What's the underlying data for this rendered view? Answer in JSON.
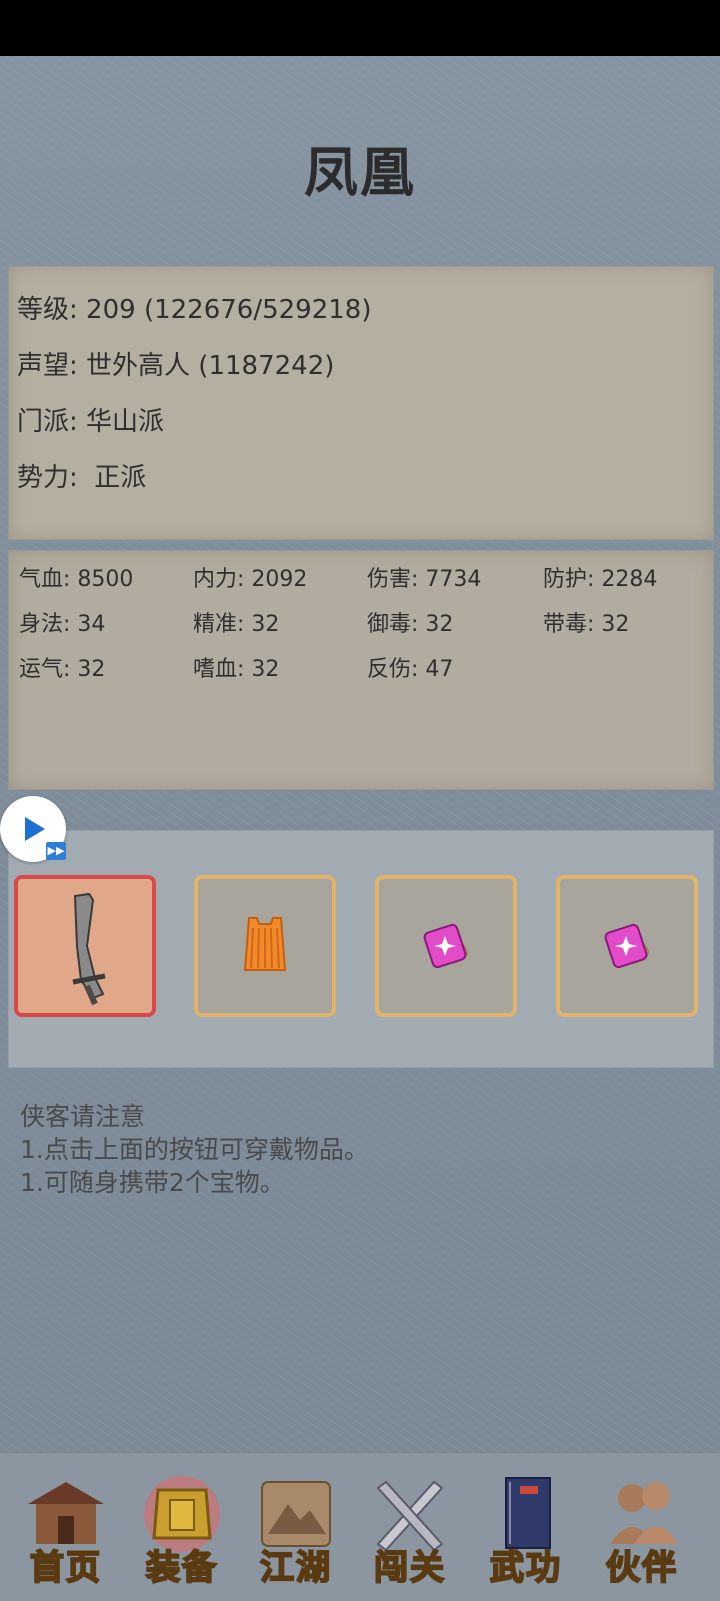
{
  "header": {
    "title": "凤凰"
  },
  "profile": [
    {
      "label": "等级",
      "value": "209 (122676/529218)"
    },
    {
      "label": "声望",
      "value": "世外高人 (1187242)"
    },
    {
      "label": "门派",
      "value": "华山派"
    },
    {
      "label": "势力",
      "value": " 正派"
    }
  ],
  "stats": [
    {
      "label": "气血",
      "value": "8500"
    },
    {
      "label": "内力",
      "value": "2092"
    },
    {
      "label": "伤害",
      "value": "7734"
    },
    {
      "label": "防护",
      "value": "2284"
    },
    {
      "label": "身法",
      "value": "34"
    },
    {
      "label": "精准",
      "value": "32"
    },
    {
      "label": "御毒",
      "value": "32"
    },
    {
      "label": "带毒",
      "value": "32"
    },
    {
      "label": "运气",
      "value": "32"
    },
    {
      "label": "嗜血",
      "value": "32"
    },
    {
      "label": "反伤",
      "value": "47"
    }
  ],
  "equipment": [
    {
      "icon": "sword-icon"
    },
    {
      "icon": "armor-vest-icon"
    },
    {
      "icon": "treasure-gem-icon"
    },
    {
      "icon": "treasure-gem-icon"
    }
  ],
  "notes": {
    "heading": "侠客请注意",
    "line1": "1.点击上面的按钮可穿戴物品。",
    "line2": "1.可随身携带2个宝物。"
  },
  "nav": [
    {
      "label": "首页",
      "icon": "home-building-icon"
    },
    {
      "label": "装备",
      "icon": "armor-icon"
    },
    {
      "label": "江湖",
      "icon": "map-scroll-icon"
    },
    {
      "label": "闯关",
      "icon": "crossed-swords-icon"
    },
    {
      "label": "武功",
      "icon": "martial-book-icon"
    },
    {
      "label": "伙伴",
      "icon": "companions-icon"
    }
  ],
  "colors": {
    "slot_border": "#e2b36a",
    "active_slot_border": "#d84a4a",
    "nav_label": "#f2c33a"
  }
}
